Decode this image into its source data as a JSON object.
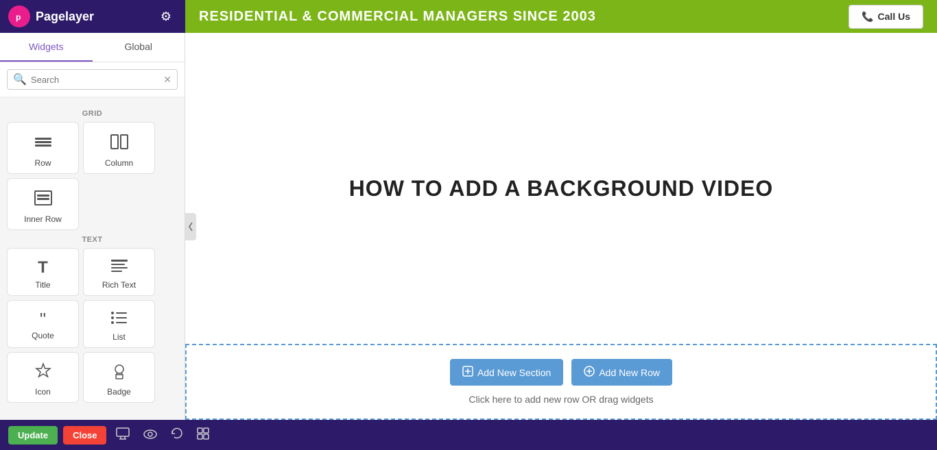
{
  "topbar": {
    "logo_letter": "p",
    "logo_text": "Pagelayer",
    "gear_icon": "⚙"
  },
  "panel": {
    "tab_widgets": "Widgets",
    "tab_global": "Global",
    "search_placeholder": "Search",
    "clear_icon": "✕",
    "sections": [
      {
        "label": "GRID",
        "widgets": [
          {
            "icon": "☰",
            "label": "Row"
          },
          {
            "icon": "⊟",
            "label": "Column"
          },
          {
            "icon": "⊞",
            "label": "Inner Row"
          }
        ]
      },
      {
        "label": "TEXT",
        "widgets": [
          {
            "icon": "T",
            "label": "Title"
          },
          {
            "icon": "≡",
            "label": "Rich Text"
          },
          {
            "icon": "❝",
            "label": "Quote"
          },
          {
            "icon": "⋮",
            "label": "List"
          },
          {
            "icon": "☆",
            "label": "Icon"
          },
          {
            "icon": "🪪",
            "label": "Badge"
          }
        ]
      }
    ]
  },
  "bottom_bar": {
    "update_label": "Update",
    "close_label": "Close",
    "desktop_icon": "🖥",
    "eye_icon": "👁",
    "history_icon": "⟳",
    "structure_icon": "⊞"
  },
  "site_header": {
    "title": "RESIDENTIAL & COMMERCIAL MANAGERS SINCE 2003",
    "call_us_label": "Call Us",
    "phone_icon": "📞"
  },
  "canvas": {
    "heading": "HOW TO ADD A BACKGROUND VIDEO",
    "add_new_section_label": "Add New Section",
    "add_new_row_label": "Add New Row",
    "add_hint": "Click here to add new row OR drag widgets",
    "section_icon": "🗋",
    "row_icon": "⊕"
  },
  "colors": {
    "purple_dark": "#2d1b69",
    "green_accent": "#7cb518",
    "blue_dashed": "#5b9bd5",
    "green_update": "#4caf50",
    "red_close": "#f44336",
    "tab_active": "#7e57c2"
  }
}
